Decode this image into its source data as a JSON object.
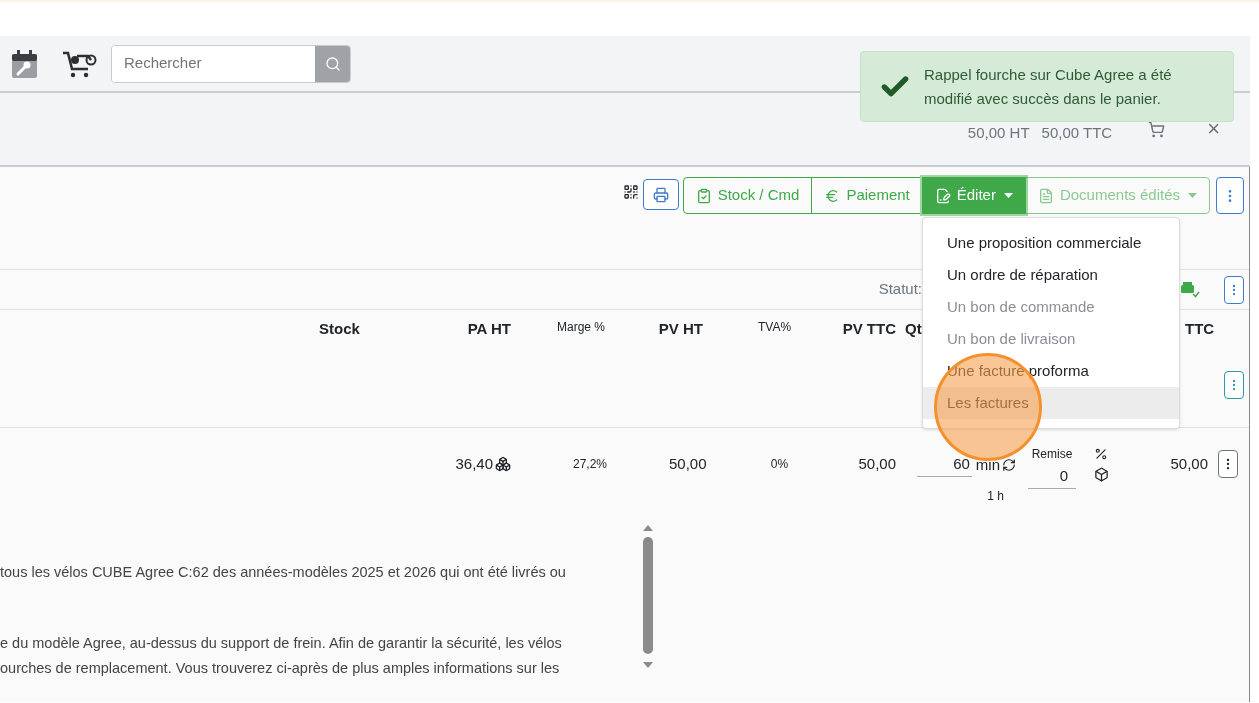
{
  "search": {
    "placeholder": "Rechercher"
  },
  "toast": {
    "message": "Rappel fourche sur Cube Agree a été modifié avec succès dans le panier."
  },
  "cart": {
    "total_ht": "50,00 HT",
    "total_ttc": "50,00 TTC",
    "close": "×"
  },
  "toolbar": {
    "buttons": [
      {
        "kind": "stock",
        "label": "Stock / Cmd",
        "selected": false,
        "disabled": false,
        "has_menu": false
      },
      {
        "kind": "payment",
        "label": "Paiement",
        "selected": false,
        "disabled": false,
        "has_menu": false
      },
      {
        "kind": "edit",
        "label": "Éditer",
        "selected": true,
        "disabled": false,
        "has_menu": true
      },
      {
        "kind": "documents",
        "label": "Documents édités",
        "selected": false,
        "disabled": true,
        "has_menu": true
      }
    ]
  },
  "edit_menu": {
    "items": [
      {
        "label": "Une proposition commerciale",
        "disabled": false,
        "selected": false
      },
      {
        "label": "Un ordre de réparation",
        "disabled": false,
        "selected": false
      },
      {
        "label": "Un bon de commande",
        "disabled": true,
        "selected": false
      },
      {
        "label": "Un bon de livraison",
        "disabled": true,
        "selected": false
      },
      {
        "label": "Une facture proforma",
        "disabled": false,
        "selected": false
      },
      {
        "label": "Les factures",
        "disabled": false,
        "selected": true
      }
    ]
  },
  "status": {
    "label": "Statut:"
  },
  "table": {
    "columns": [
      "Stock",
      "PA HT",
      "Marge %",
      "PV HT",
      "TVA%",
      "PV TTC",
      "Qt",
      "TTC"
    ],
    "rows": [
      {
        "pa_ht": "36,40",
        "marge": "27,2%",
        "pv_ht": "50,00",
        "tva": "0%",
        "pv_ttc": "50,00",
        "qty": "60",
        "unit": "min",
        "duration": "1 h",
        "discount_label": "Remise",
        "discount": "0",
        "total": "50,00"
      }
    ]
  },
  "description": {
    "lines": [
      "tous les vélos CUBE Agree C:62 des années-modèles 2025 et 2026 qui ont été livrés ou",
      "e du modèle Agree, au-dessus du support de frein. Afin de garantir la sécurité, les vélos",
      "ourches de remplacement. Vous trouverez ci-après de plus amples informations sur les"
    ]
  }
}
